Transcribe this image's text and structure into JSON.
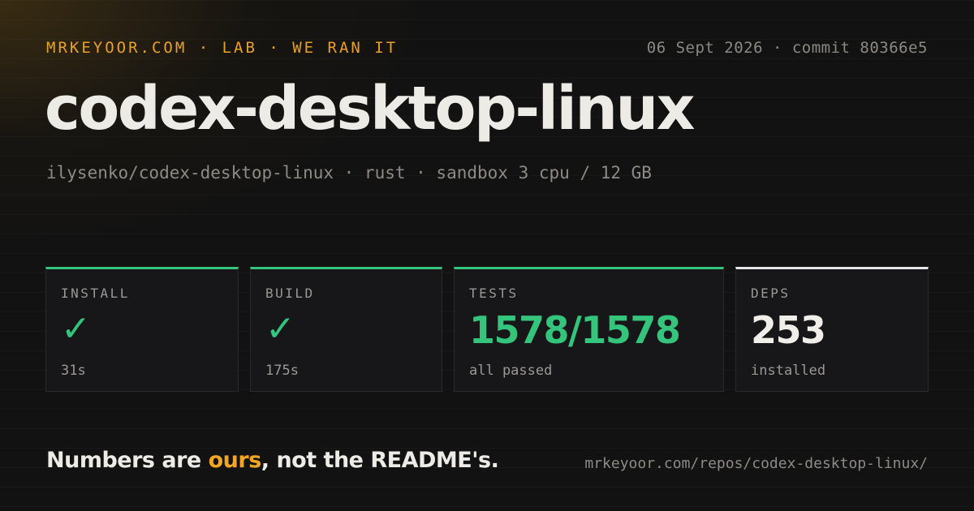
{
  "header": {
    "kicker": "MRKEYOOR.COM · LAB · WE RAN IT",
    "meta": "06 Sept 2026 · commit 80366e5"
  },
  "title": "codex-desktop-linux",
  "subtitle": "ilysenko/codex-desktop-linux · rust · sandbox 3 cpu / 12 GB",
  "cards": [
    {
      "label": "INSTALL",
      "value": "✓",
      "sub": "31s",
      "status": "pass",
      "color": "#34c47c"
    },
    {
      "label": "BUILD",
      "value": "✓",
      "sub": "175s",
      "status": "pass",
      "color": "#34c47c"
    },
    {
      "label": "TESTS",
      "value": "1578/1578",
      "sub": "all passed",
      "status": "pass",
      "color": "#34c47c"
    },
    {
      "label": "DEPS",
      "value": "253",
      "sub": "installed",
      "status": "neutral",
      "color": "#efeee9"
    }
  ],
  "footer": {
    "tagline_pre": "Numbers are ",
    "tagline_accent": "ours",
    "tagline_post": ", not the README's.",
    "url": "mrkeyoor.com/repos/codex-desktop-linux/"
  },
  "colors": {
    "accent": "#f0a623",
    "pass": "#34c47c",
    "background": "#121212"
  }
}
